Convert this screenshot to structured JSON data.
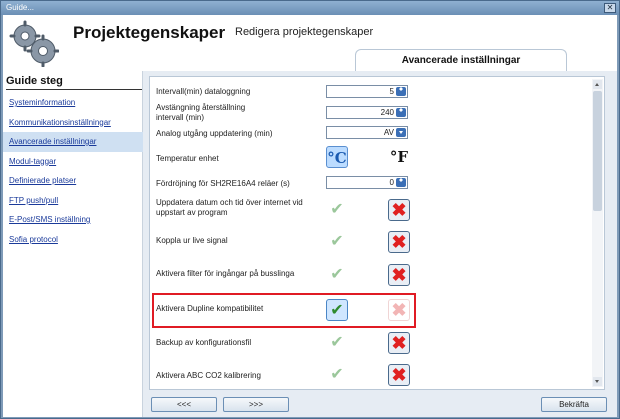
{
  "window": {
    "title": "Guide...",
    "close_label": "✕"
  },
  "header": {
    "title": "Projektegenskaper",
    "subtitle": "Redigera projektegenskaper",
    "active_tab": "Avancerade inställningar"
  },
  "sidebar": {
    "title": "Guide steg",
    "items": [
      {
        "label": "Systeminformation",
        "active": false
      },
      {
        "label": "Kommunikationsinställningar",
        "active": false
      },
      {
        "label": "Avancerade inställningar",
        "active": true
      },
      {
        "label": "Modul-taggar",
        "active": false
      },
      {
        "label": "Definierade platser",
        "active": false
      },
      {
        "label": "FTP push/pull",
        "active": false
      },
      {
        "label": "E-Post/SMS inställning",
        "active": false
      },
      {
        "label": "Sofia protocol",
        "active": false
      }
    ]
  },
  "settings": {
    "interval_label": "Intervall(min) dataloggning",
    "interval_value": "5",
    "reset_label": "Avstängning återställning intervall (min)",
    "reset_value": "240",
    "analog_label": "Analog utgång uppdatering (min)",
    "analog_value": "AV",
    "temp_label": "Temperatur enhet",
    "celsius": "°C",
    "fahrenheit": "°F",
    "delay_label": "Fördröjning för SH2RE16A4 reläer (s)",
    "delay_value": "0",
    "update_label": "Uppdatera datum och tid över internet vid uppstart av program",
    "live_label": "Koppla ur live signal",
    "filter_label": "Aktivera filter för ingångar på busslinga",
    "dupline_label": "Aktivera Dupline kompatibilitet",
    "backup_label": "Backup av konfigurationsfil",
    "co2_label": "Aktivera ABC CO2 kalibrering"
  },
  "icons": {
    "check": "✔",
    "cross": "✖"
  },
  "buttons": {
    "back": "<<<",
    "next": ">>>",
    "confirm": "Bekräfta"
  }
}
